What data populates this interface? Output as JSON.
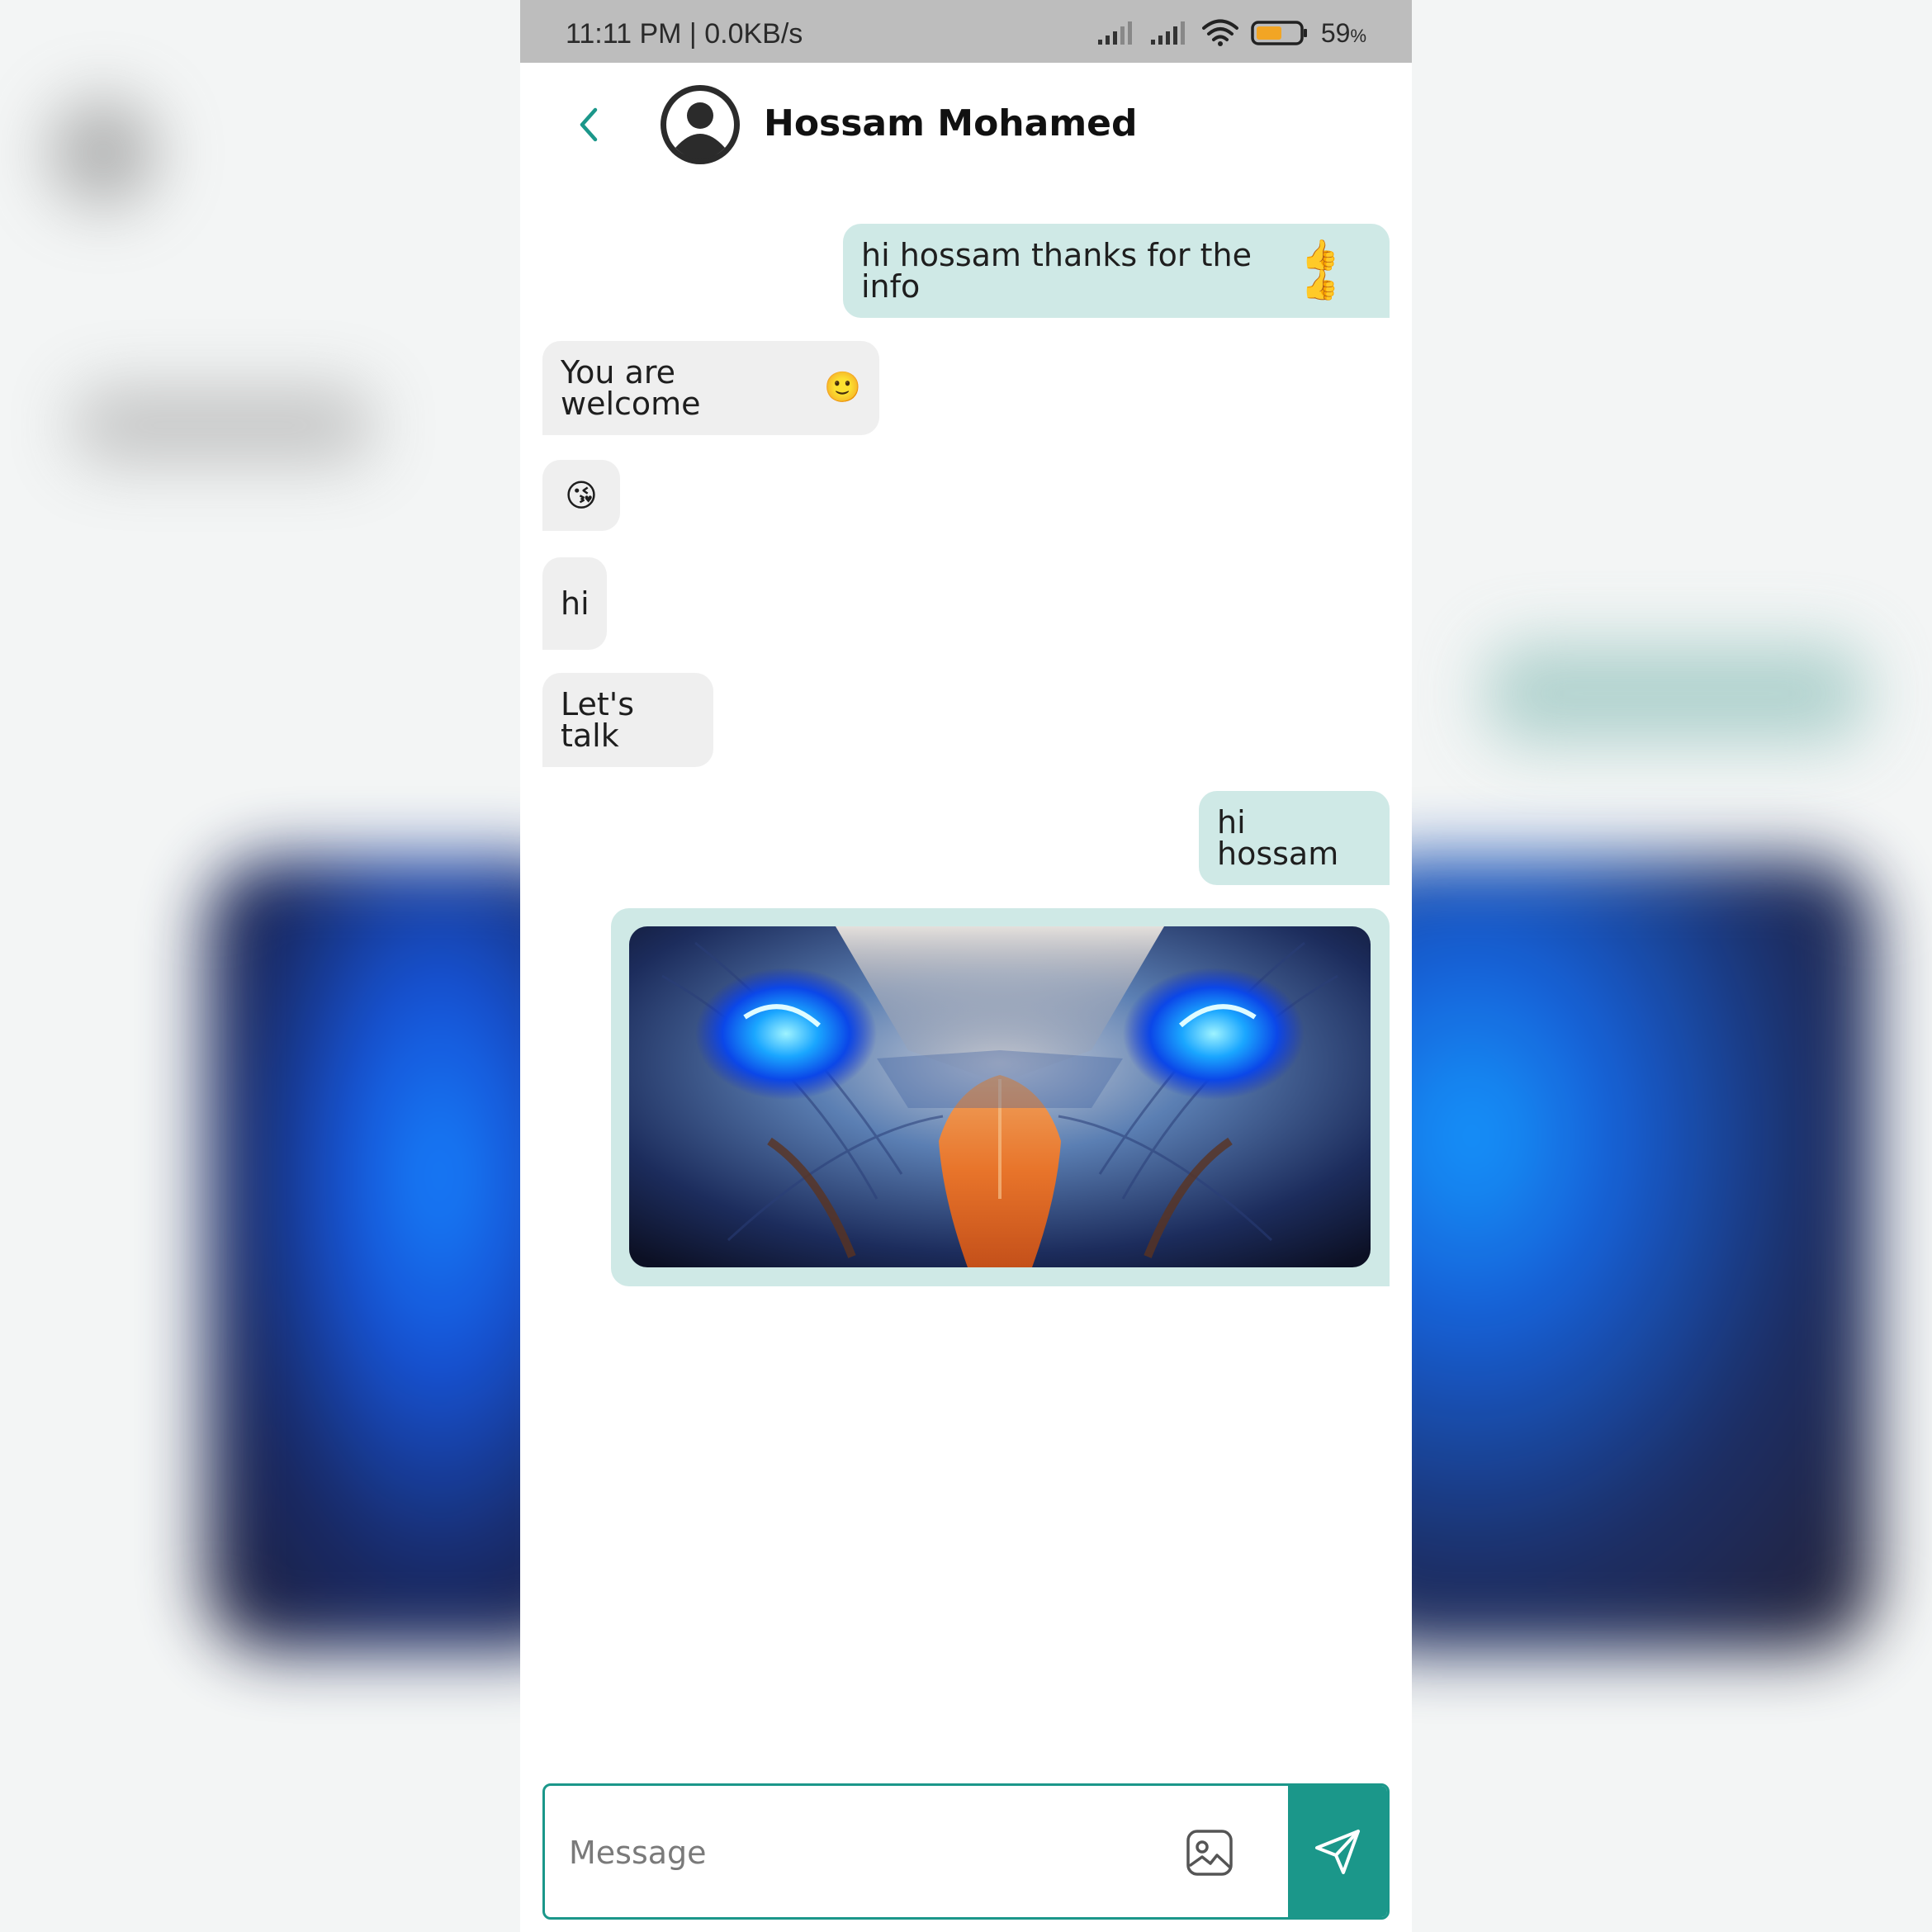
{
  "status_bar": {
    "time_speed": "11:11 PM | 0.0KB/s",
    "battery_percent": "59",
    "battery_unit": "%",
    "battery_level": 0.59,
    "icons": [
      "signal-icon",
      "signal-icon",
      "wifi-icon",
      "battery-icon"
    ]
  },
  "header": {
    "contact_name": "Hossam Mohamed",
    "back_icon": "chevron-left-icon",
    "avatar_icon": "user-avatar-icon"
  },
  "messages": [
    {
      "direction": "outgoing",
      "text": "hi hossam thanks for the info",
      "emoji": "👍👍"
    },
    {
      "direction": "incoming",
      "text": "You are welcome",
      "emoji": "🙂"
    },
    {
      "direction": "incoming",
      "text": "",
      "emoji": "😘"
    },
    {
      "direction": "incoming",
      "text": "hi",
      "emoji": ""
    },
    {
      "direction": "incoming",
      "text": "Let's talk",
      "emoji": ""
    },
    {
      "direction": "outgoing",
      "text": "hi hossam",
      "emoji": ""
    },
    {
      "direction": "outgoing",
      "type": "image",
      "image": "eagle-photo"
    }
  ],
  "composer": {
    "placeholder": "Message",
    "value": "",
    "gallery_icon": "image-icon",
    "send_icon": "send-icon"
  },
  "colors": {
    "accent": "#1b978a",
    "outgoing_bubble": "#cfe9e6",
    "incoming_bubble": "#efefef",
    "status_bar": "#bdbdbd"
  }
}
